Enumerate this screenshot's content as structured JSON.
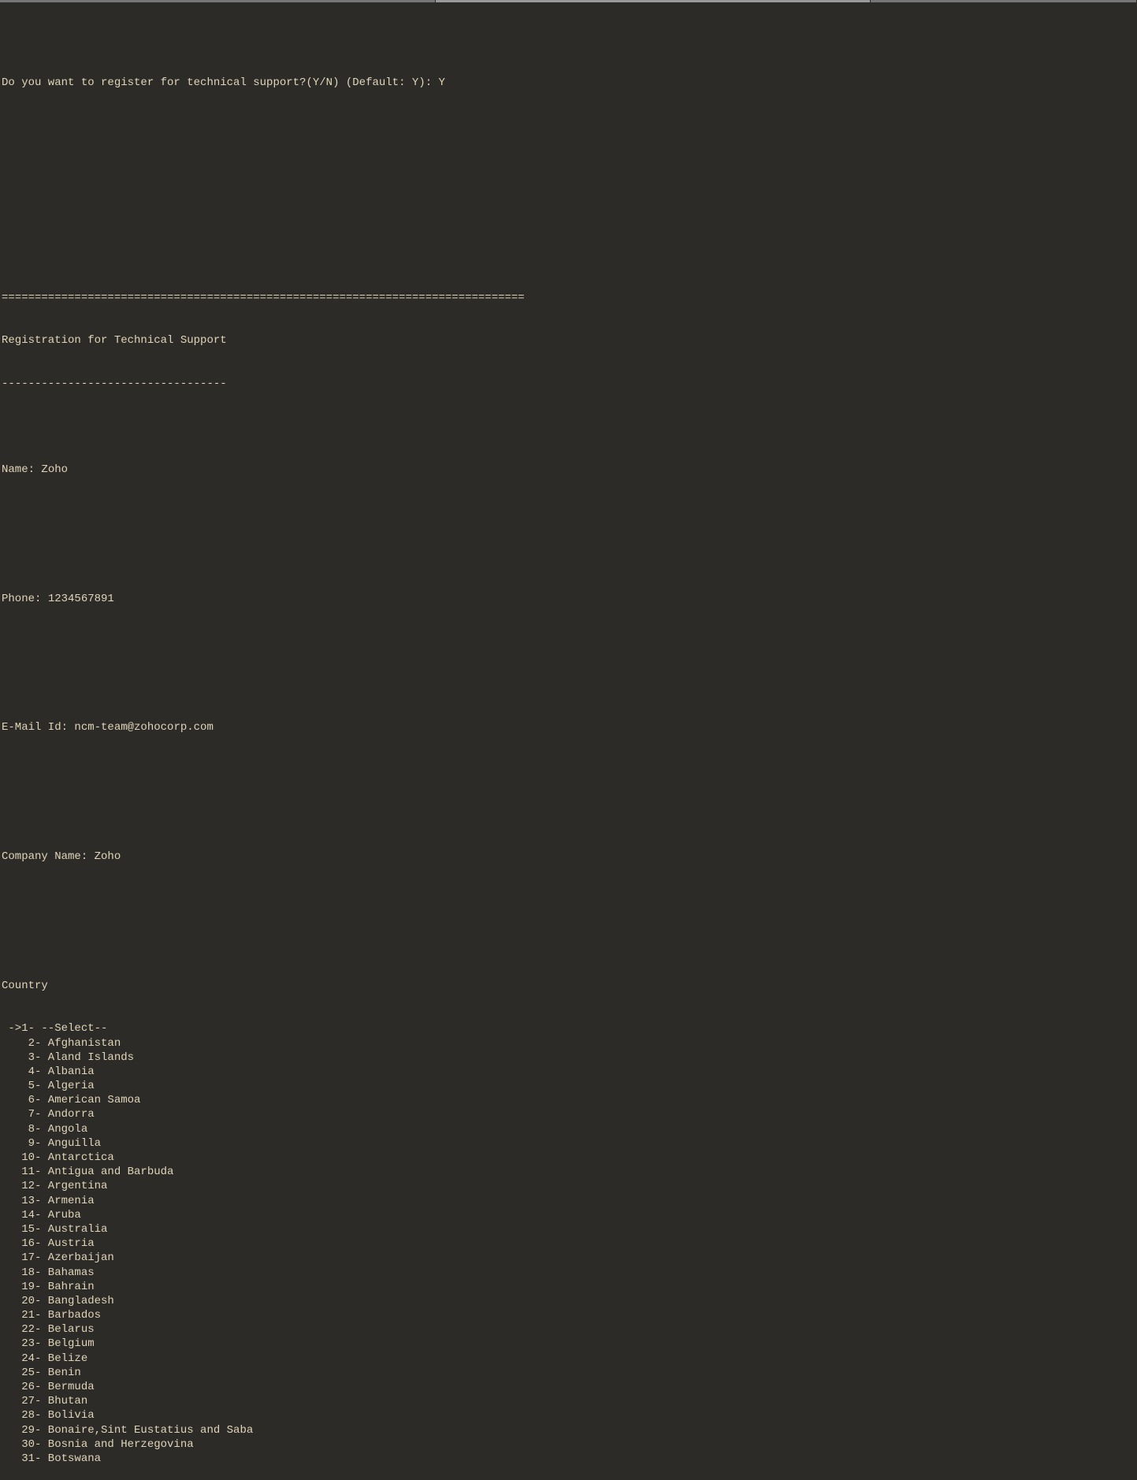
{
  "prompt": {
    "question": "Do you want to register for technical support?(Y/N) (Default: Y): ",
    "answer": "Y"
  },
  "separator": "===============================================================================",
  "header": "Registration for Technical Support",
  "subsep": "----------------------------------",
  "fields": {
    "name_label": "Name: ",
    "name_value": "Zoho",
    "phone_label": "Phone: ",
    "phone_value": "1234567891",
    "email_label": "E-Mail Id: ",
    "email_value": "ncm-team@zohocorp.com",
    "company_label": "Company Name: ",
    "company_value": "Zoho"
  },
  "country_label": "Country",
  "selected_index": 1,
  "countries": [
    {
      "n": 1,
      "label": "--Select--"
    },
    {
      "n": 2,
      "label": "Afghanistan"
    },
    {
      "n": 3,
      "label": "Aland Islands"
    },
    {
      "n": 4,
      "label": "Albania"
    },
    {
      "n": 5,
      "label": "Algeria"
    },
    {
      "n": 6,
      "label": "American Samoa"
    },
    {
      "n": 7,
      "label": "Andorra"
    },
    {
      "n": 8,
      "label": "Angola"
    },
    {
      "n": 9,
      "label": "Anguilla"
    },
    {
      "n": 10,
      "label": "Antarctica"
    },
    {
      "n": 11,
      "label": "Antigua and Barbuda"
    },
    {
      "n": 12,
      "label": "Argentina"
    },
    {
      "n": 13,
      "label": "Armenia"
    },
    {
      "n": 14,
      "label": "Aruba"
    },
    {
      "n": 15,
      "label": "Australia"
    },
    {
      "n": 16,
      "label": "Austria"
    },
    {
      "n": 17,
      "label": "Azerbaijan"
    },
    {
      "n": 18,
      "label": "Bahamas"
    },
    {
      "n": 19,
      "label": "Bahrain"
    },
    {
      "n": 20,
      "label": "Bangladesh"
    },
    {
      "n": 21,
      "label": "Barbados"
    },
    {
      "n": 22,
      "label": "Belarus"
    },
    {
      "n": 23,
      "label": "Belgium"
    },
    {
      "n": 24,
      "label": "Belize"
    },
    {
      "n": 25,
      "label": "Benin"
    },
    {
      "n": 26,
      "label": "Bermuda"
    },
    {
      "n": 27,
      "label": "Bhutan"
    },
    {
      "n": 28,
      "label": "Bolivia"
    },
    {
      "n": 29,
      "label": "Bonaire,Sint Eustatius and Saba"
    },
    {
      "n": 30,
      "label": "Bosnia and Herzegovina"
    },
    {
      "n": 31,
      "label": "Botswana"
    }
  ]
}
